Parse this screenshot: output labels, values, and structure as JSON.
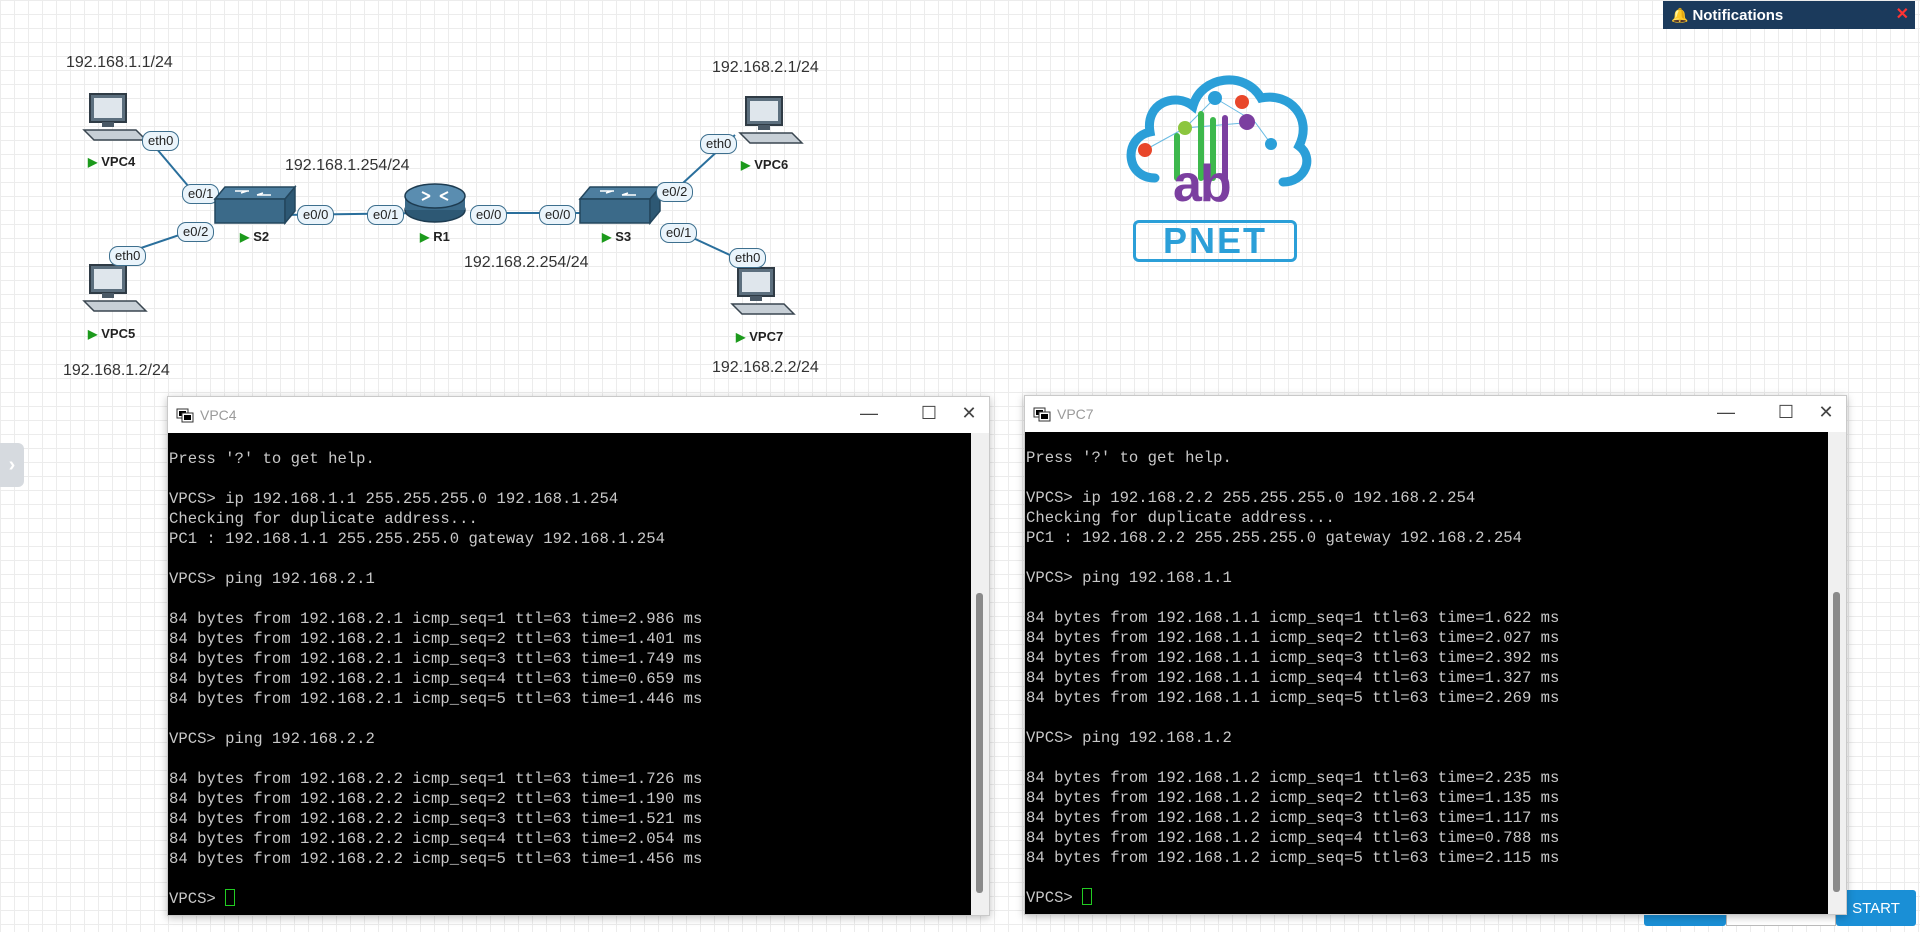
{
  "topology": {
    "ip_labels": {
      "vpc4": "192.168.1.1/24",
      "vpc5": "192.168.1.2/24",
      "r1_left": "192.168.1.254/24",
      "r1_right": "192.168.2.254/24",
      "vpc6": "192.168.2.1/24",
      "vpc7": "192.168.2.2/24"
    },
    "nodes": {
      "vpc4": "VPC4",
      "vpc5": "VPC5",
      "s2": "S2",
      "r1": "R1",
      "s3": "S3",
      "vpc6": "VPC6",
      "vpc7": "VPC7"
    },
    "interfaces": {
      "vpc4_eth0": "eth0",
      "s2_e01": "e0/1",
      "vpc5_eth0": "eth0",
      "s2_e02": "e0/2",
      "s2_e00": "e0/0",
      "r1_e01": "e0/1",
      "r1_e00": "e0/0",
      "s3_e00": "e0/0",
      "s3_e02": "e0/2",
      "vpc6_eth0": "eth0",
      "s3_e01": "e0/1",
      "vpc7_eth0": "eth0"
    },
    "logo_text": "PNET",
    "logo_lab": "ab"
  },
  "notifications": {
    "title": "Notifications"
  },
  "windows": [
    {
      "title": "VPC4",
      "lines": [
        "Press '?' to get help.",
        "",
        "VPCS> ip 192.168.1.1 255.255.255.0 192.168.1.254",
        "Checking for duplicate address...",
        "PC1 : 192.168.1.1 255.255.255.0 gateway 192.168.1.254",
        "",
        "VPCS> ping 192.168.2.1",
        "",
        "84 bytes from 192.168.2.1 icmp_seq=1 ttl=63 time=2.986 ms",
        "84 bytes from 192.168.2.1 icmp_seq=2 ttl=63 time=1.401 ms",
        "84 bytes from 192.168.2.1 icmp_seq=3 ttl=63 time=1.749 ms",
        "84 bytes from 192.168.2.1 icmp_seq=4 ttl=63 time=0.659 ms",
        "84 bytes from 192.168.2.1 icmp_seq=5 ttl=63 time=1.446 ms",
        "",
        "VPCS> ping 192.168.2.2",
        "",
        "84 bytes from 192.168.2.2 icmp_seq=1 ttl=63 time=1.726 ms",
        "84 bytes from 192.168.2.2 icmp_seq=2 ttl=63 time=1.190 ms",
        "84 bytes from 192.168.2.2 icmp_seq=3 ttl=63 time=1.521 ms",
        "84 bytes from 192.168.2.2 icmp_seq=4 ttl=63 time=2.054 ms",
        "84 bytes from 192.168.2.2 icmp_seq=5 ttl=63 time=1.456 ms",
        ""
      ],
      "prompt": "VPCS> "
    },
    {
      "title": "VPC7",
      "lines": [
        "Press '?' to get help.",
        "",
        "VPCS> ip 192.168.2.2 255.255.255.0 192.168.2.254",
        "Checking for duplicate address...",
        "PC1 : 192.168.2.2 255.255.255.0 gateway 192.168.2.254",
        "",
        "VPCS> ping 192.168.1.1",
        "",
        "84 bytes from 192.168.1.1 icmp_seq=1 ttl=63 time=1.622 ms",
        "84 bytes from 192.168.1.1 icmp_seq=2 ttl=63 time=2.027 ms",
        "84 bytes from 192.168.1.1 icmp_seq=3 ttl=63 time=2.392 ms",
        "84 bytes from 192.168.1.1 icmp_seq=4 ttl=63 time=1.327 ms",
        "84 bytes from 192.168.1.1 icmp_seq=5 ttl=63 time=2.269 ms",
        "",
        "VPCS> ping 192.168.1.2",
        "",
        "84 bytes from 192.168.1.2 icmp_seq=1 ttl=63 time=2.235 ms",
        "84 bytes from 192.168.1.2 icmp_seq=2 ttl=63 time=1.135 ms",
        "84 bytes from 192.168.1.2 icmp_seq=3 ttl=63 time=1.117 ms",
        "84 bytes from 192.168.1.2 icmp_seq=4 ttl=63 time=0.788 ms",
        "84 bytes from 192.168.1.2 icmp_seq=5 ttl=63 time=2.115 ms",
        ""
      ],
      "prompt": "VPCS> "
    }
  ],
  "buttons": {
    "start": "START"
  },
  "colors": {
    "accent": "#1a8fd6",
    "notif_bg": "#1b3a5c",
    "link": "#2a6f9c",
    "run": "#1c9a1c"
  }
}
